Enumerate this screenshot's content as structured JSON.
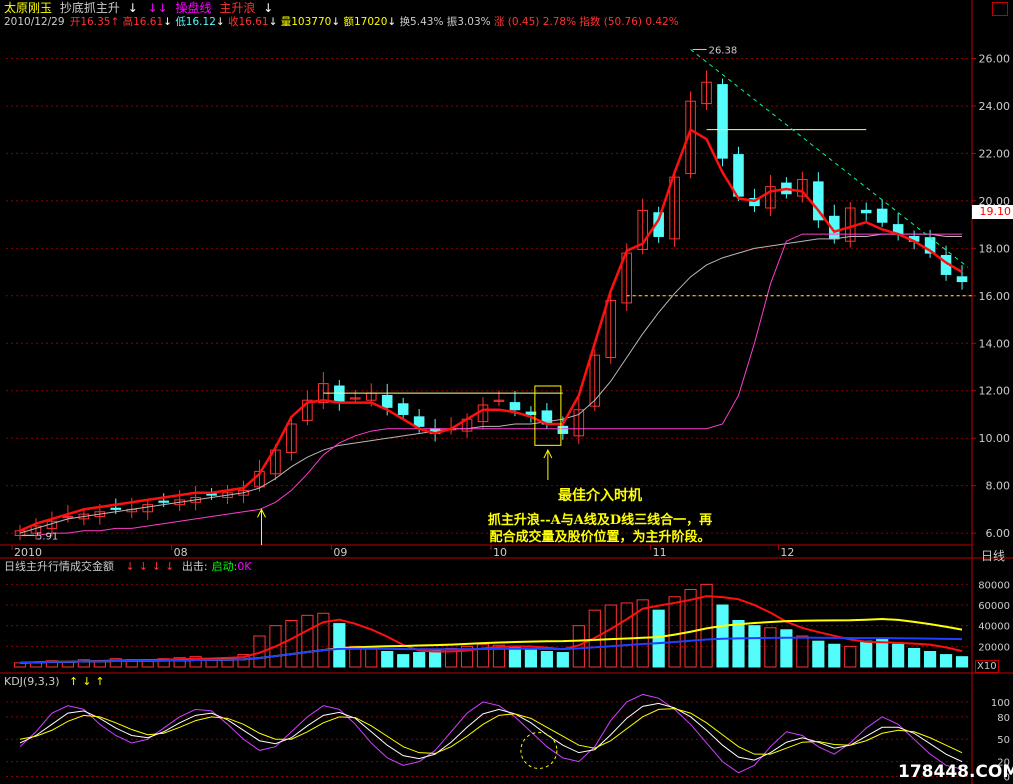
{
  "title_bar": {
    "stock_name": "太原刚玉",
    "indicator_name": "抄底抓主升",
    "arrow1": "↓",
    "arrows_pink": "↓↓",
    "line_label_a": "操盘线",
    "line_label_b": "主升浪",
    "arrow_end": "↓"
  },
  "quote_bar": {
    "date": "2010/12/29",
    "open": "开16.35",
    "high": "高16.61",
    "low": "低16.12",
    "close": "收16.61",
    "volume": "量103770",
    "amount": "额17020",
    "turnover": "换5.43%",
    "amplitude": "振3.03%",
    "change": "涨 (0.45) 2.78%",
    "index": "指数 (50.76) 0.42%",
    "arrow_down": "↓",
    "arrow_up": "↑"
  },
  "price_axis": [
    "26.00",
    "24.00",
    "22.00",
    "20.00",
    "18.00",
    "16.00",
    "14.00",
    "12.00",
    "10.00",
    "8.00",
    "6.00"
  ],
  "current_price": "19.10",
  "high_label": "26.38",
  "low_label": "5.91",
  "x_axis": [
    "2010",
    "08",
    "09",
    "10",
    "11",
    "12"
  ],
  "period_label": "日线",
  "annotation": {
    "headline": "最佳介入时机",
    "line1": "抓主升浪--A与A线及D线三线合一，再",
    "line2": "配合成交量及股价位置，为主升阶段。"
  },
  "volume_panel": {
    "title": "日线主升行情成交金额",
    "arrows": "↓↓↓↓",
    "signal_out": "出击:",
    "signal_start": "启动:",
    "signal_value": "0K",
    "axis": [
      "80000",
      "60000",
      "40000",
      "20000"
    ],
    "unit": "X10"
  },
  "kdj_panel": {
    "title": "KDJ(9,3,3)",
    "arrows": "↑↓↑",
    "axis": [
      "100",
      "80",
      "50",
      "20",
      "0"
    ]
  },
  "watermark": "178448.COM",
  "colors": {
    "up": "#ff3232",
    "down": "#54fcfc",
    "grid": "#8b0000",
    "axis": "#c00000",
    "yellow": "#ffff00",
    "magenta": "#ff00ff"
  },
  "chart_data": [
    {
      "type": "candlestick",
      "title": "太原刚玉",
      "ylim": [
        5.5,
        27.2
      ],
      "y_ticks": [
        26,
        24,
        22,
        20,
        18,
        16,
        14,
        12,
        10,
        8,
        6
      ],
      "x_labels": [
        "2010",
        "08",
        "09",
        "10",
        "11",
        "12"
      ],
      "high_marker": 26.38,
      "low_marker": 5.91,
      "current": 19.1,
      "close_series": [
        6.1,
        6.3,
        6.5,
        6.7,
        6.8,
        6.9,
        7.0,
        7.0,
        7.2,
        7.3,
        7.4,
        7.5,
        7.6,
        7.7,
        7.8,
        8.6,
        9.5,
        10.6,
        11.6,
        12.3,
        11.5,
        11.7,
        11.9,
        11.3,
        11.0,
        10.5,
        10.2,
        10.4,
        10.8,
        11.4,
        11.6,
        11.2,
        11.0,
        10.6,
        10.2,
        11.2,
        13.5,
        15.8,
        17.8,
        19.6,
        18.5,
        21.0,
        24.2,
        25.0,
        21.8,
        20.2,
        19.8,
        20.6,
        20.3,
        20.9,
        19.2,
        18.4,
        19.7,
        19.5,
        19.1,
        18.6,
        18.3,
        17.8,
        16.9,
        16.6
      ],
      "ma_lines": {
        "red_main": [
          6.1,
          6.4,
          6.6,
          6.8,
          7.0,
          7.1,
          7.2,
          7.3,
          7.4,
          7.5,
          7.6,
          7.7,
          7.7,
          7.8,
          7.9,
          8.5,
          9.6,
          10.9,
          11.5,
          11.6,
          11.5,
          11.5,
          11.5,
          11.2,
          10.8,
          10.4,
          10.2,
          10.4,
          10.8,
          11.2,
          11.2,
          11.1,
          10.9,
          10.6,
          10.6,
          11.8,
          14.0,
          16.2,
          17.9,
          18.2,
          19.2,
          21.2,
          23.0,
          22.6,
          21.2,
          20.1,
          20.0,
          20.4,
          20.5,
          20.4,
          19.6,
          18.7,
          18.9,
          19.1,
          18.8,
          18.6,
          18.3,
          17.9,
          17.4,
          17.0
        ],
        "gray_mid": [
          6.0,
          6.2,
          6.4,
          6.6,
          6.7,
          6.8,
          6.9,
          7.0,
          7.1,
          7.2,
          7.3,
          7.4,
          7.5,
          7.6,
          7.7,
          7.9,
          8.3,
          8.8,
          9.2,
          9.5,
          9.7,
          9.8,
          9.9,
          10.0,
          10.1,
          10.2,
          10.3,
          10.4,
          10.4,
          10.5,
          10.5,
          10.6,
          10.6,
          10.7,
          10.8,
          11.0,
          11.6,
          12.4,
          13.4,
          14.4,
          15.3,
          16.1,
          16.8,
          17.3,
          17.6,
          17.8,
          18.0,
          18.1,
          18.2,
          18.3,
          18.4,
          18.4,
          18.5,
          18.5,
          18.6,
          18.6,
          18.6,
          18.6,
          18.5,
          18.5
        ],
        "magenta_low": [
          5.9,
          5.9,
          6.0,
          6.0,
          6.1,
          6.1,
          6.2,
          6.2,
          6.3,
          6.4,
          6.5,
          6.6,
          6.7,
          6.8,
          6.9,
          7.0,
          7.3,
          7.8,
          8.5,
          9.3,
          9.8,
          10.1,
          10.3,
          10.4,
          10.4,
          10.4,
          10.4,
          10.4,
          10.4,
          10.4,
          10.4,
          10.4,
          10.4,
          10.4,
          10.4,
          10.4,
          10.4,
          10.4,
          10.4,
          10.4,
          10.4,
          10.4,
          10.4,
          10.4,
          10.6,
          11.8,
          14.0,
          16.5,
          18.3,
          18.6,
          18.6,
          18.6,
          18.6,
          18.6,
          18.6,
          18.6,
          18.6,
          18.6,
          18.6,
          18.6
        ]
      }
    },
    {
      "type": "bar",
      "title": "日线主升行情成交金额",
      "ylim": [
        0,
        90000
      ],
      "y_ticks": [
        80000,
        60000,
        40000,
        20000
      ],
      "values": [
        4000,
        5000,
        6000,
        5000,
        7000,
        6000,
        8000,
        7000,
        6000,
        8000,
        9000,
        10000,
        8000,
        9000,
        12000,
        30000,
        40000,
        45000,
        50000,
        52000,
        42000,
        20000,
        18000,
        15000,
        12000,
        14000,
        16000,
        18000,
        20000,
        22000,
        21000,
        19000,
        17000,
        15000,
        14000,
        40000,
        55000,
        60000,
        62000,
        65000,
        55000,
        68000,
        75000,
        80000,
        60000,
        45000,
        40000,
        38000,
        36000,
        30000,
        25000,
        22000,
        20000,
        25000,
        28000,
        22000,
        18000,
        15000,
        12000,
        10000
      ]
    },
    {
      "type": "line",
      "title": "KDJ(9,3,3)",
      "ylim": [
        -10,
        120
      ],
      "y_ticks": [
        100,
        80,
        50,
        20,
        0
      ],
      "series": [
        {
          "values": [
            40,
            60,
            85,
            95,
            90,
            70,
            55,
            45,
            50,
            65,
            80,
            90,
            88,
            70,
            50,
            35,
            40,
            60,
            80,
            95,
            90,
            70,
            45,
            25,
            15,
            20,
            35,
            60,
            85,
            100,
            95,
            80,
            60,
            40,
            25,
            20,
            40,
            75,
            100,
            110,
            105,
            90,
            70,
            45,
            20,
            5,
            15,
            40,
            60,
            55,
            40,
            30,
            45,
            65,
            80,
            70,
            50,
            30,
            15,
            10
          ]
        },
        {
          "values": [
            45,
            55,
            70,
            85,
            88,
            78,
            65,
            55,
            52,
            60,
            72,
            82,
            85,
            76,
            62,
            48,
            44,
            52,
            68,
            82,
            86,
            78,
            60,
            42,
            28,
            24,
            30,
            46,
            66,
            84,
            90,
            84,
            72,
            56,
            42,
            32,
            36,
            56,
            78,
            94,
            98,
            92,
            80,
            62,
            42,
            26,
            22,
            32,
            46,
            52,
            46,
            38,
            42,
            54,
            66,
            66,
            58,
            44,
            30,
            20
          ]
        },
        {
          "values": [
            50,
            54,
            62,
            74,
            82,
            80,
            72,
            63,
            56,
            58,
            66,
            75,
            80,
            78,
            70,
            58,
            50,
            50,
            60,
            72,
            80,
            79,
            68,
            54,
            40,
            32,
            31,
            40,
            54,
            70,
            82,
            84,
            78,
            66,
            54,
            42,
            38,
            48,
            64,
            80,
            90,
            91,
            85,
            72,
            56,
            40,
            30,
            30,
            38,
            46,
            47,
            43,
            42,
            48,
            58,
            62,
            60,
            52,
            42,
            32
          ]
        }
      ]
    }
  ]
}
